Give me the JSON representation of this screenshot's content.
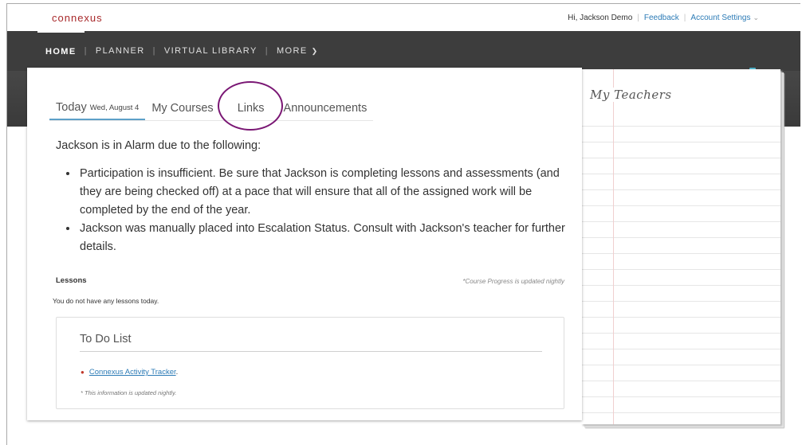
{
  "header": {
    "logo": "connexus",
    "greeting": "Hi, Jackson Demo",
    "feedback": "Feedback",
    "account_settings": "Account Settings"
  },
  "nav": {
    "items": [
      "HOME",
      "PLANNER",
      "VIRTUAL LIBRARY",
      "MORE"
    ]
  },
  "tabs": {
    "today": "Today",
    "today_date": "Wed, August 4",
    "my_courses": "My Courses",
    "links": "Links",
    "announcements": "Announcements"
  },
  "alarm": {
    "heading": "Jackson is in Alarm due to the following:",
    "reasons": [
      "Participation is insufficient. Be sure that Jackson is completing lessons and assessments (and they are being checked off) at a pace that will ensure that all of the assigned work will be completed by the end of the year.",
      "Jackson was manually placed into Escalation Status. Consult with Jackson's teacher for further details."
    ]
  },
  "lessons": {
    "heading": "Lessons",
    "progress_note": "*Course Progress is updated nightly",
    "empty_text": "You do not have any lessons today."
  },
  "todo": {
    "title": "To Do List",
    "item_link": "Connexus Activity Tracker",
    "item_suffix": ".",
    "note": "* This information is updated nightly."
  },
  "teachers": {
    "title": "My Teachers"
  },
  "colors": {
    "nav_bg": "#3d3d3d",
    "link": "#2c7bb6",
    "tab_underline": "#5ca0c8",
    "annotation_circle": "#7a1774",
    "logo": "#a8292b"
  }
}
